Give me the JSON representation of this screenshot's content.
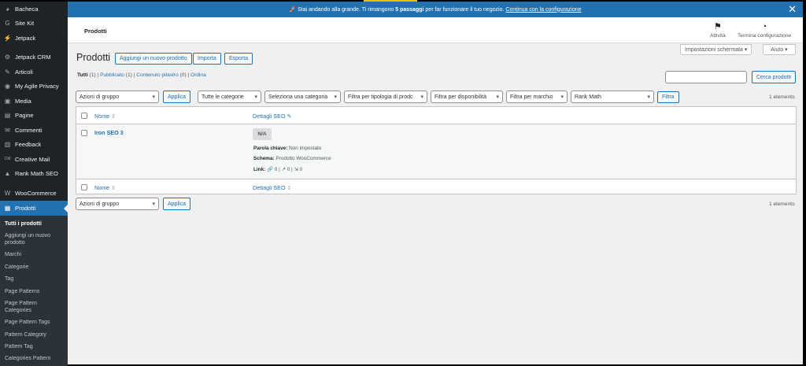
{
  "sidebar": {
    "items": [
      {
        "label": "Bacheca",
        "icon": "dashboard-icon",
        "glyph": "◕"
      },
      {
        "label": "Site Kit",
        "icon": "sitekit-icon",
        "glyph": "G"
      },
      {
        "label": "Jetpack",
        "icon": "jetpack-icon",
        "glyph": "⚡"
      },
      {
        "label": "Jetpack CRM",
        "icon": "crm-icon",
        "glyph": "⚙"
      },
      {
        "label": "Articoli",
        "icon": "pin-icon",
        "glyph": "✎"
      },
      {
        "label": "My Agile Privacy",
        "icon": "privacy-icon",
        "glyph": "◉"
      },
      {
        "label": "Media",
        "icon": "media-icon",
        "glyph": "▣"
      },
      {
        "label": "Pagine",
        "icon": "page-icon",
        "glyph": "▤"
      },
      {
        "label": "Commenti",
        "icon": "comment-icon",
        "glyph": "✉"
      },
      {
        "label": "Feedback",
        "icon": "feedback-icon",
        "glyph": "▥"
      },
      {
        "label": "Creative Mail",
        "icon": "creativemail-icon",
        "glyph": "CM"
      },
      {
        "label": "Rank Math SEO",
        "icon": "rankmath-icon",
        "glyph": "▲"
      },
      {
        "label": "WooCommerce",
        "icon": "woocommerce-icon",
        "glyph": "W"
      },
      {
        "label": "Prodotti",
        "icon": "products-icon",
        "glyph": "▦"
      }
    ],
    "submenu": [
      "Tutti i prodotti",
      "Aggiungi un nuovo prodotto",
      "Marchi",
      "Categorie",
      "Tag",
      "Page Patterns",
      "Page Pattern Categories",
      "Page Pattern Tags",
      "Pattern Category",
      "Pattern Tag",
      "Categories Pattern"
    ]
  },
  "notice": {
    "text_before": "🚀 Stai andando alla grande. Ti rimangono",
    "bold": "5 passaggi",
    "text_after": "per far funzionare il tuo negozio.",
    "link": "Continua con la configurazione",
    "close": "✕"
  },
  "topbar": {
    "title": "Prodotti",
    "activity": "Attività",
    "setup": "Termina configurazione"
  },
  "screen_options": "Impostazioni schermata ▾",
  "help": "Aiuto ▾",
  "page": {
    "title": "Prodotti",
    "add_new": "Aggiungi un nuovo prodotto",
    "import": "Importa",
    "export": "Esporta"
  },
  "views": {
    "all": "Tutti",
    "all_count": "(1)",
    "published": "Pubblicato",
    "published_count": "(1)",
    "draft": "Contenuto pilastro",
    "draft_count": "(0)",
    "order": "Ordina",
    "sep": "|"
  },
  "search": {
    "button": "Cerca prodotti",
    "value": ""
  },
  "filters": {
    "bulk": "Azioni di gruppo",
    "apply": "Applica",
    "categories": "Tutte le categorie",
    "select_category": "Seleziona una categoria",
    "product_type": "Filtra per tipologia di prodc",
    "stock": "Filtra per disponibilità",
    "brand": "Filtra per marchio",
    "rankmath": "Rank Math",
    "filter_btn": "Filtra",
    "count": "1 elemento"
  },
  "table": {
    "col_name": "Nome",
    "col_seo": "Dettagli SEO",
    "sort": "⇕",
    "product": {
      "name": "Iron SEO 3",
      "badge": "N/A",
      "keyword_label": "Parola chiave:",
      "keyword_value": "Non impostato",
      "schema_label": "Schema:",
      "schema_value": "Prodotto WooCommerce",
      "link_label": "Link:",
      "links": [
        "0",
        "0",
        "0"
      ]
    }
  },
  "bottom": {
    "bulk": "Azioni di gruppo",
    "apply": "Applica",
    "count": "1 elemento"
  }
}
